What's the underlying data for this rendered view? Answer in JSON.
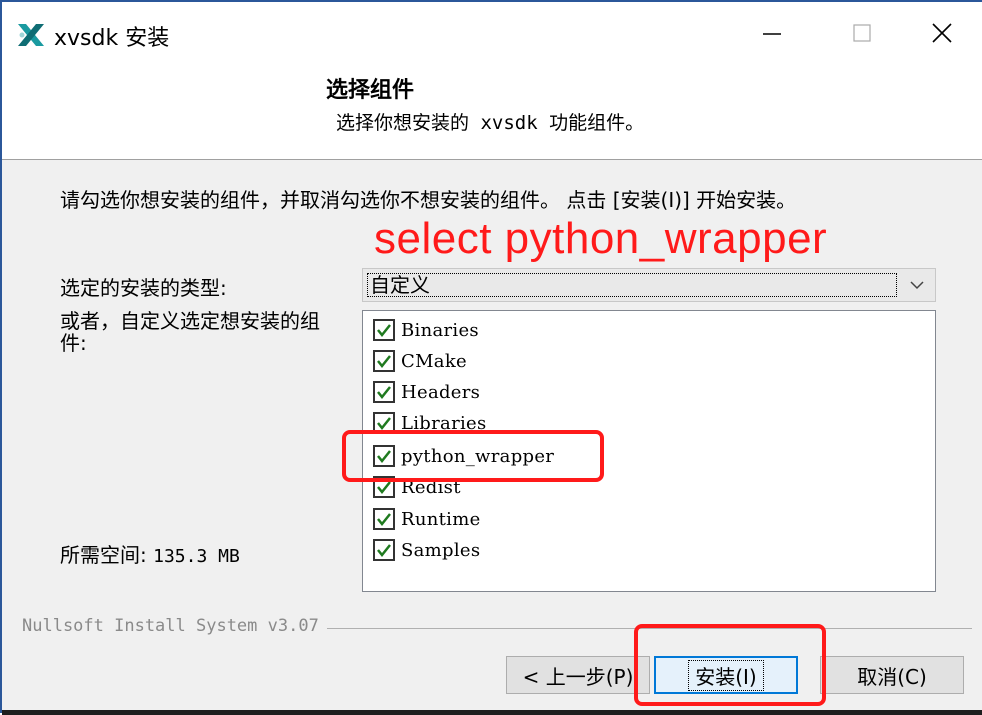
{
  "window": {
    "title": "xvsdk 安装",
    "controls": {
      "minimize": "—",
      "maximize": "☐",
      "close": "✕"
    }
  },
  "header": {
    "title": "选择组件",
    "subtitle": "选择你想安装的 xvsdk 功能组件。"
  },
  "body": {
    "instructions": "请勾选你想安装的组件，并取消勾选你不想安装的组件。 点击 [安装(I)] 开始安装。",
    "annotation": "select python_wrapper",
    "install_type_label": "选定的安装的类型:",
    "install_type_value": "自定义",
    "custom_label": "或者，自定义选定想安装的组件:",
    "space_label": "所需空间: ",
    "space_value": "135.3 MB",
    "components": [
      {
        "label": "Binaries",
        "checked": true
      },
      {
        "label": "CMake",
        "checked": true
      },
      {
        "label": "Headers",
        "checked": true
      },
      {
        "label": "Libraries",
        "checked": true
      },
      {
        "label": "python_wrapper",
        "checked": true
      },
      {
        "label": "Redist",
        "checked": true
      },
      {
        "label": "Runtime",
        "checked": true
      },
      {
        "label": "Samples",
        "checked": true
      }
    ]
  },
  "footer": {
    "nsis": "Nullsoft Install System v3.07",
    "back_label": "< 上一步(P)",
    "install_label": "安装(I)",
    "cancel_label": "取消(C)"
  },
  "colors": {
    "annotation": "#ff1a1a",
    "checkmark": "#1f7a1f",
    "focus": "#0078d7"
  }
}
